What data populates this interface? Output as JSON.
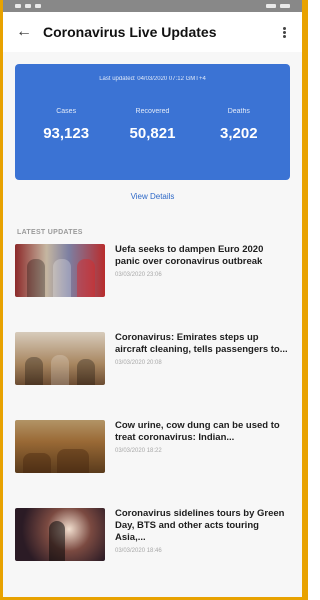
{
  "header": {
    "title": "Coronavirus Live Updates"
  },
  "stats": {
    "last_updated": "Last updated: 04/03/2020 07:12 GMT+4",
    "cases": {
      "label": "Cases",
      "value": "93,123"
    },
    "recovered": {
      "label": "Recovered",
      "value": "50,821"
    },
    "deaths": {
      "label": "Deaths",
      "value": "3,202"
    },
    "view_details": "View Details"
  },
  "section": {
    "latest_updates_label": "LATEST UPDATES"
  },
  "updates": [
    {
      "headline": "Uefa seeks to dampen Euro 2020 panic over coronavirus outbreak",
      "date": "03/03/2020 23:06"
    },
    {
      "headline": "Coronavirus: Emirates steps up aircraft cleaning, tells passengers to...",
      "date": "03/03/2020 20:08"
    },
    {
      "headline": "Cow urine, cow dung can be used to treat coronavirus: Indian...",
      "date": "03/03/2020 18:22"
    },
    {
      "headline": "Coronavirus sidelines tours by Green Day, BTS and other acts touring Asia,...",
      "date": "03/03/2020 18:46"
    }
  ],
  "colors": {
    "accent": "#3b73d4",
    "link": "#2d68c7",
    "frame_highlight": "#e8a200"
  },
  "icons": {
    "back": "arrow-left-icon",
    "menu": "more-vertical-icon"
  }
}
